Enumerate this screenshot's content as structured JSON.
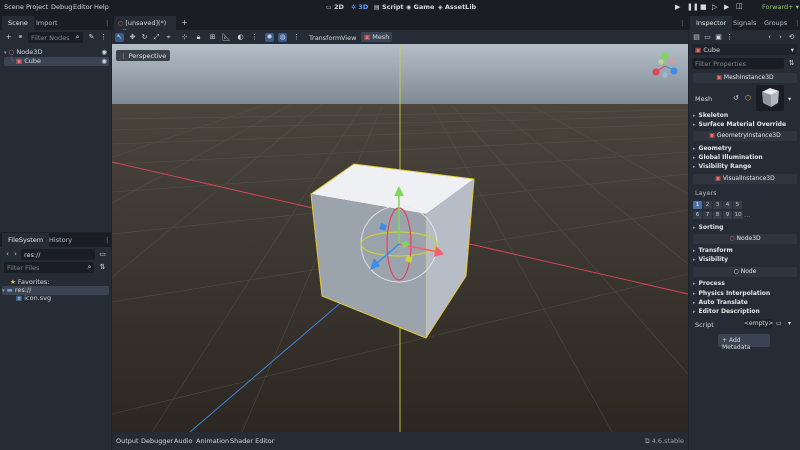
{
  "menu": {
    "items": [
      "Scene",
      "Project",
      "Debug",
      "Editor",
      "Help"
    ]
  },
  "workspaces": {
    "twod": "2D",
    "threed": "3D",
    "script": "Script",
    "game": "Game",
    "assetlib": "AssetLib"
  },
  "renderer": "Forward+",
  "scene_panel": {
    "tabs": [
      "Scene",
      "Import"
    ],
    "filter_placeholder": "Filter Nodes",
    "nodes": [
      {
        "name": "Node3D"
      },
      {
        "name": "Cube"
      }
    ]
  },
  "fs_panel": {
    "tabs": [
      "FileSystem",
      "History"
    ],
    "path": "res://",
    "filter_placeholder": "Filter Files",
    "favorites": "Favorites:",
    "root": "res://",
    "file": "icon.svg"
  },
  "editor": {
    "tab_label": "[unsaved](*)",
    "toolbar_labels": {
      "transform": "Transform",
      "view": "View",
      "mesh": "Mesh"
    },
    "viewport_label": "Perspective"
  },
  "bottom": {
    "tabs": [
      "Output",
      "Debugger",
      "Audio",
      "Animation",
      "Shader Editor"
    ],
    "version": "4.6.stable"
  },
  "inspector": {
    "tabs": [
      "Inspector",
      "Signals",
      "Groups"
    ],
    "node_name": "Cube",
    "filter_placeholder": "Filter Properties",
    "class_mesh": "MeshInstance3D",
    "mesh_label": "Mesh",
    "mesh_sections": [
      "Skeleton",
      "Surface Material Override"
    ],
    "class_geometry": "GeometryInstance3D",
    "geometry_sections": [
      "Geometry",
      "Global Illumination",
      "Visibility Range"
    ],
    "class_visual": "VisualInstance3D",
    "layers_label": "Layers",
    "layers_row1": [
      "1",
      "2",
      "3",
      "4",
      "5"
    ],
    "layers_row2": [
      "6",
      "7",
      "8",
      "9",
      "10"
    ],
    "layers_more": "...",
    "sorting": "Sorting",
    "class_node3d": "Node3D",
    "node3d_sections": [
      "Transform",
      "Visibility"
    ],
    "class_node": "Node",
    "node_sections": [
      "Process",
      "Physics Interpolation",
      "Auto Translate",
      "Editor Description"
    ],
    "script_label": "Script",
    "script_value": "<empty>",
    "add_metadata": "Add Metadata"
  }
}
